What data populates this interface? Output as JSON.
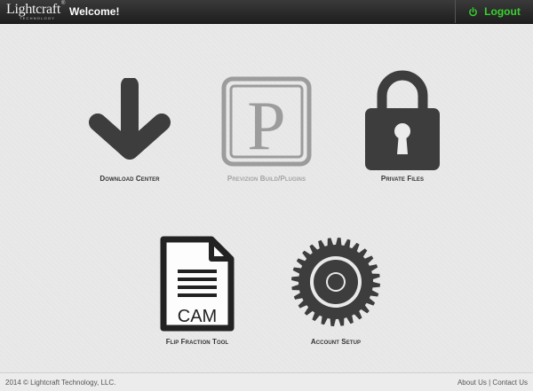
{
  "header": {
    "logo_text": "Lightcraft",
    "logo_subtext": "TECHNOLOGY",
    "logo_mark": "®",
    "welcome": "Welcome!",
    "logout_label": "Logout",
    "logout_icon": "power-icon",
    "accent_color": "#39d12e",
    "bar_color": "#2a2a2a"
  },
  "tiles": [
    {
      "label": "Download Center",
      "icon": "download-arrow-icon",
      "enabled": true
    },
    {
      "label": "Previzion Build/Plugins",
      "icon": "previzion-p-icon",
      "enabled": false,
      "icon_glyph": "P"
    },
    {
      "label": "Private Files",
      "icon": "padlock-icon",
      "enabled": true
    },
    {
      "label": "Flip Fraction Tool",
      "icon": "cam-document-icon",
      "enabled": true,
      "icon_glyph": "CAM"
    },
    {
      "label": "Account Setup",
      "icon": "gear-icon",
      "enabled": true
    }
  ],
  "footer": {
    "copyright": "2014 © Lightcraft Technology, LLC.",
    "about_link": "About Us",
    "separator": "|",
    "contact_link": "Contact Us"
  }
}
